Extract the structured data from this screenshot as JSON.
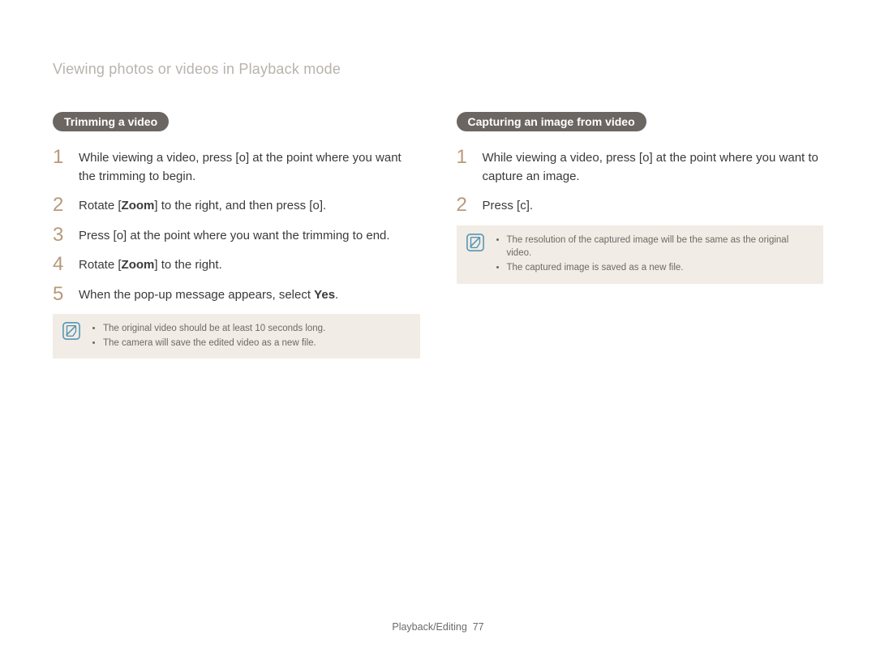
{
  "breadcrumb": "Viewing photos or videos in Playback mode",
  "left": {
    "heading": "Trimming a video",
    "steps": [
      {
        "n": "1",
        "pre": "While viewing a video, press [",
        "key": "o",
        "post": "] at the point where you want the trimming to begin."
      },
      {
        "n": "2",
        "pre": "Rotate [",
        "bold": "Zoom",
        "mid": "] to the right, and then press [",
        "key": "o",
        "post": "]."
      },
      {
        "n": "3",
        "pre": "Press [",
        "key": "o",
        "post": "] at the point where you want the trimming to end."
      },
      {
        "n": "4",
        "pre": "Rotate [",
        "bold": "Zoom",
        "post": "] to the right."
      },
      {
        "n": "5",
        "pre": "When the pop-up message appears, select ",
        "bold": "Yes",
        "post": "."
      }
    ],
    "notes": [
      "The original video should be at least 10 seconds long.",
      "The camera will save the edited video as a new file."
    ]
  },
  "right": {
    "heading": "Capturing an image from video",
    "steps": [
      {
        "n": "1",
        "pre": "While viewing a video, press [",
        "key": "o",
        "post": "] at the point where you want to capture an image."
      },
      {
        "n": "2",
        "pre": "Press [",
        "key": "c",
        "post": "]."
      }
    ],
    "notes": [
      "The resolution of the captured image will be the same as the original video.",
      "The captured image is saved as a new file."
    ]
  },
  "footer": {
    "section": "Playback/Editing",
    "page": "77"
  }
}
